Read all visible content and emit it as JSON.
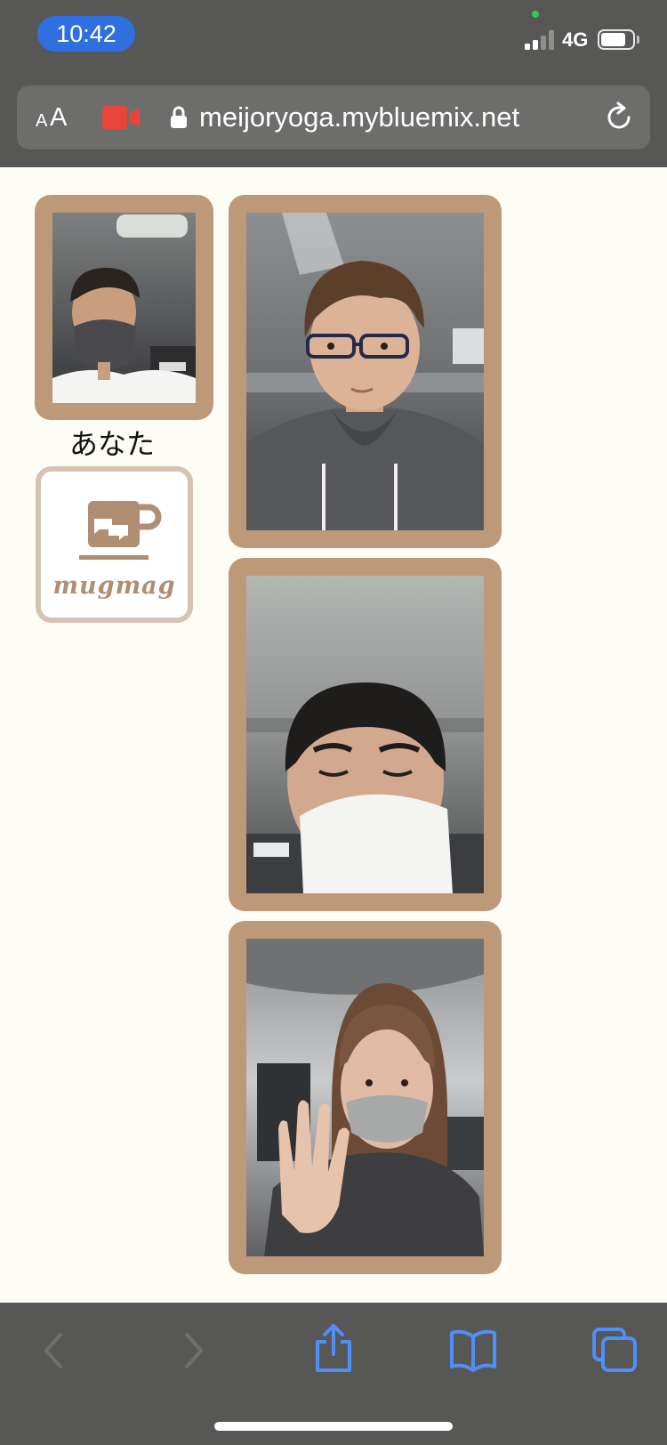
{
  "status_bar": {
    "time": "10:42",
    "network": "4G",
    "battery_level": 0.8,
    "signal_bars": 2,
    "signal_bars_total": 4
  },
  "browser": {
    "text_size_small": "A",
    "text_size_large": "A",
    "url": "meijoryoga.mybluemix.net",
    "colors": {
      "chrome": "#575855",
      "field": "#6d6e6b",
      "camera_indicator": "#e8443a",
      "toolbar_active": "#4f8ff7",
      "toolbar_disabled": "#6f706d"
    },
    "icons": {
      "camera": "video-camera-icon",
      "lock": "lock-icon",
      "reload": "reload-icon"
    }
  },
  "page": {
    "self_label": "あなた",
    "logo_text": "mugmag",
    "frame_color": "#bd9879",
    "background": "#fdfcf5",
    "videos": [
      {
        "name": "self-video",
        "description_icon": "person-icon"
      },
      {
        "name": "participant-video-1",
        "description_icon": "person-icon"
      },
      {
        "name": "participant-video-2",
        "description_icon": "person-icon"
      },
      {
        "name": "participant-video-3",
        "description_icon": "person-icon"
      }
    ]
  },
  "toolbar": {
    "items": [
      {
        "icon": "back-icon",
        "enabled": false
      },
      {
        "icon": "forward-icon",
        "enabled": false
      },
      {
        "icon": "share-icon",
        "enabled": true
      },
      {
        "icon": "bookmarks-icon",
        "enabled": true
      },
      {
        "icon": "tabs-icon",
        "enabled": true
      }
    ]
  }
}
